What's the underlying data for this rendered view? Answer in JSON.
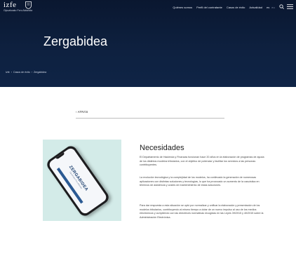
{
  "header": {
    "logo_word": "izfe",
    "logo_sub": "Gipuzkoako Foru Aldundia",
    "nav": [
      "Quiénes somos",
      "Perfil del contratante",
      "Casos de éxito",
      "Actualidad"
    ],
    "languages": [
      "es",
      "eu"
    ],
    "active_language": "es"
  },
  "hero": {
    "title": "Zergabidea",
    "breadcrumb": [
      "Izfe",
      "Casos de éxito",
      "Zergabidea"
    ]
  },
  "back_link": "ATRÁS",
  "content": {
    "heading": "Necesidades",
    "paragraphs": [
      "El Departamento de Hacienda y Finanzas funcionan hace 20 años en la elaboración de programas de ayuda de los distintos modelos tributarios, con el objetivo de potenciar y facilitar los servicios a las personas contribuyentes.",
      "La evolución tecnológica y la complejidad de los modelos, ha conllevado la generación de numerosas aplicaciones con distintas soluciones y tecnologías, lo que ha provocado un aumento de la casuística en términos de asistencia y costes de mantenimiento de estas soluciones.",
      "Para dar respuesta a esta situación se optó por normalizar y unificar la elaboración y presentación de los modelos tributarios, contribuyendo al mismo tiempo a dotar de un nuevo impulso al uso de los medios electrónicos y cumpliendo con las directrices normativas recogidas en las Leyes 39/2015 y 40/2015 sobre la Administración Electrónica."
    ]
  },
  "phone_screen": {
    "brand": "ZERGABIDEA",
    "tagline": "Gipuzkoako Foru Aldundia"
  },
  "colors": {
    "hero_bg": "#0e2140",
    "image_panel": "#d3ebe8",
    "text": "#444444"
  }
}
